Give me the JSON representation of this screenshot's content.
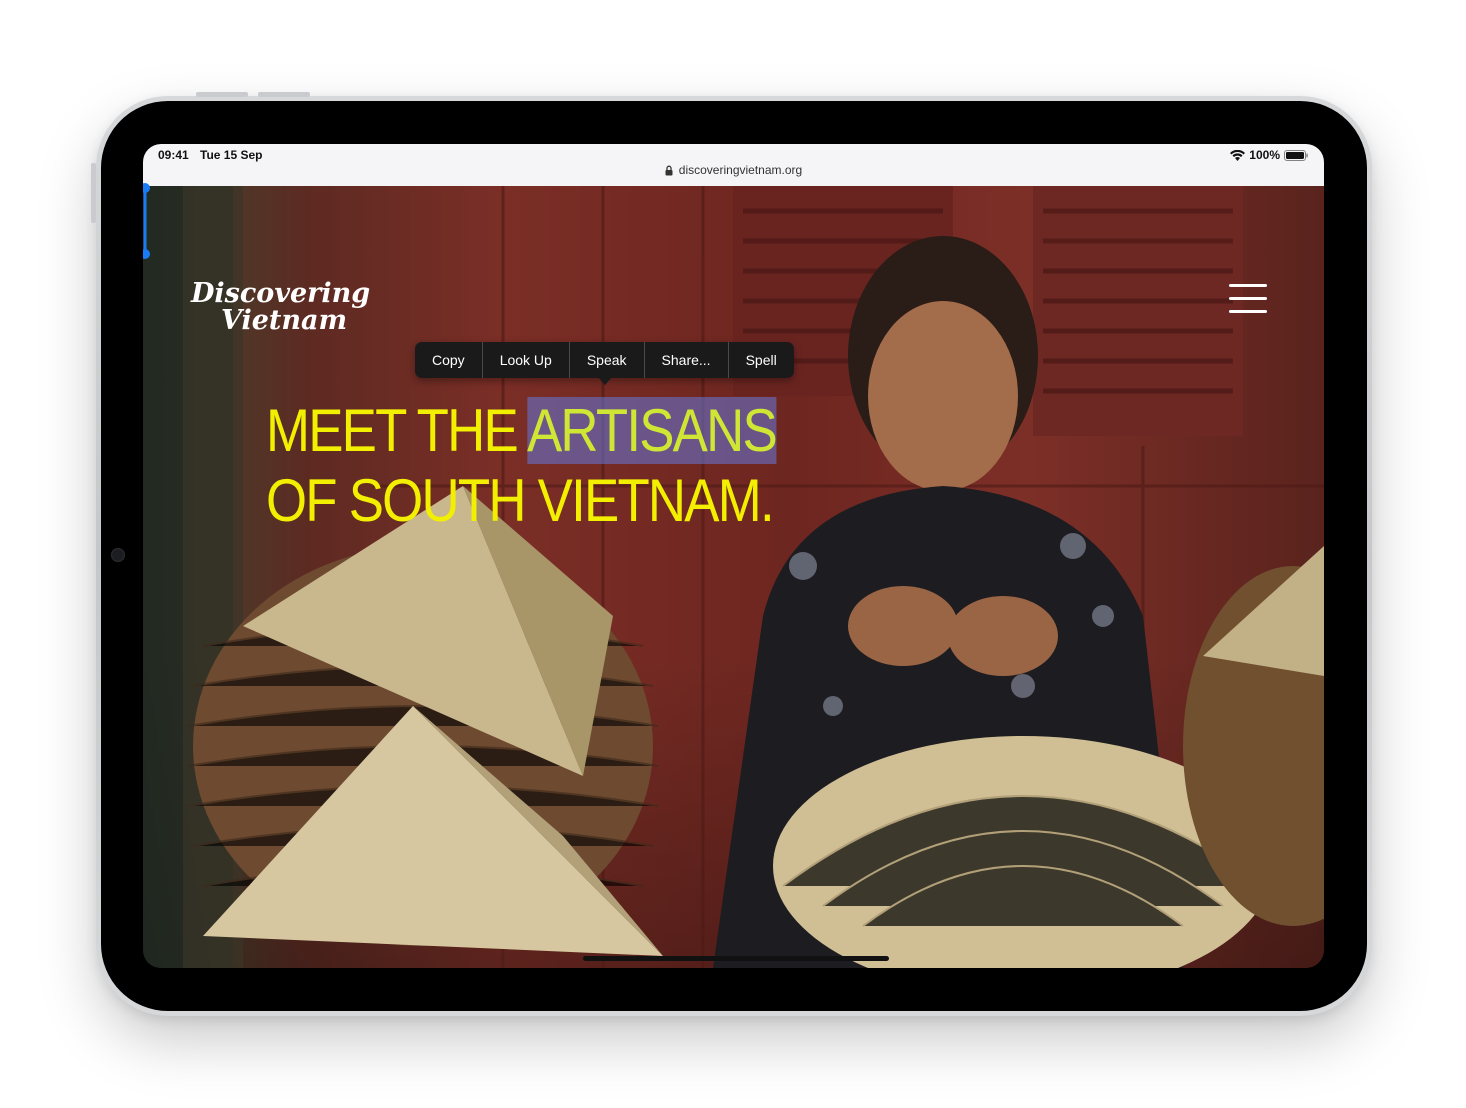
{
  "status_bar": {
    "time": "09:41",
    "date": "Tue 15 Sep",
    "battery": "100%",
    "url": "discoveringvietnam.org"
  },
  "site": {
    "logo_line1": "Discovering",
    "logo_line2": "Vietnam",
    "headline_before": "MEET THE ",
    "headline_selected": "ARTISANS",
    "headline_line2": "OF SOUTH VIETNAM."
  },
  "context_menu": {
    "items": [
      "Copy",
      "Look Up",
      "Speak",
      "Share...",
      "Spell"
    ]
  },
  "colors": {
    "headline": "#f2f000",
    "selection": "#6478dc",
    "menu_bg": "#1a1a1a"
  }
}
